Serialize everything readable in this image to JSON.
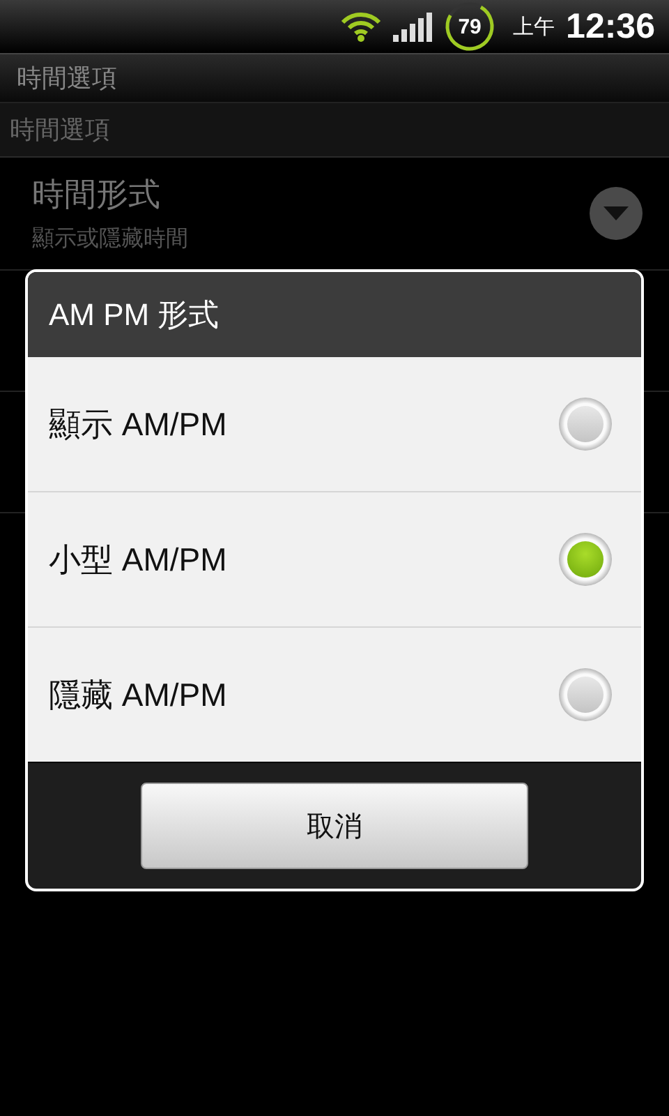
{
  "status_bar": {
    "battery": "79",
    "period": "上午",
    "time": "12:36"
  },
  "title_bar": {
    "title": "時間選項"
  },
  "category": {
    "title": "時間選項"
  },
  "setting": {
    "title": "時間形式",
    "summary": "顯示或隱藏時間"
  },
  "dialog": {
    "title": "AM PM 形式",
    "options": [
      {
        "label": "顯示 AM/PM",
        "selected": false
      },
      {
        "label": "小型 AM/PM",
        "selected": true
      },
      {
        "label": "隱藏 AM/PM",
        "selected": false
      }
    ],
    "buttons": [
      "取消"
    ]
  }
}
